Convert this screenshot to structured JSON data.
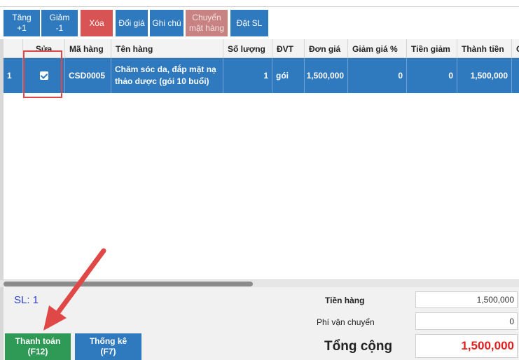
{
  "toolbar": {
    "inc": "Tăng\n+1",
    "dec": "Giảm\n-1",
    "del": "Xóa",
    "change_price": "Đổi giá",
    "note": "Ghi chú",
    "transfer": "Chuyển\nmặt hàng",
    "set_qty": "Đặt SL"
  },
  "table": {
    "headers": [
      "",
      "Sửa",
      "Mã hàng",
      "Tên hàng",
      "Số lượng",
      "ĐVT",
      "Đơn giá",
      "Giảm giá %",
      "Tiền giảm",
      "Thành tiền",
      "G"
    ],
    "rows": [
      {
        "stt": "1",
        "checked": true,
        "code": "CSD0005",
        "name": "Chăm sóc da, đắp mặt nạ thảo dược (gói 10 buổi)",
        "qty": "1",
        "unit": "gói",
        "price": "1,500,000",
        "discount_pct": "0",
        "discount_amt": "0",
        "total": "1,500,000"
      }
    ]
  },
  "summary": {
    "count_label": "SL: 1",
    "subtotal_label": "Tiền hàng",
    "subtotal_value": "1,500,000",
    "shipping_label": "Phí vận chuyển",
    "shipping_value": "0",
    "total_label": "Tổng cộng",
    "total_value": "1,500,000"
  },
  "actions": {
    "pay": "Thanh toán\n(F12)",
    "stats": "Thống kê\n(F7)"
  },
  "colors": {
    "primary": "#2f79bf",
    "danger": "#d85353",
    "pay": "#2f9a55",
    "total": "#e01f1f",
    "annotation": "#e04848"
  }
}
